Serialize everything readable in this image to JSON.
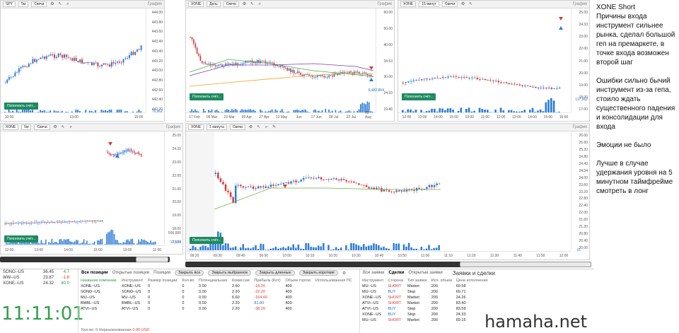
{
  "panels": {
    "p1": {
      "symbol": "SPY",
      "tf": "5м",
      "type": "Свечи",
      "graph": "График",
      "y": [
        "444.00",
        "443.80",
        "443.60",
        "443.49",
        "443.40",
        "443.20",
        "443.00",
        "442.80",
        "442.60",
        "442.40",
        "442.20"
      ],
      "x": [
        "10:00",
        "13:00",
        "15:00"
      ],
      "vol": "76,962",
      "btn": "Пополнить счёт..."
    },
    "p2": {
      "symbol": "XONE",
      "tf": "День",
      "type": "Свечи",
      "graph": "График",
      "y": [
        "60.00",
        "50.00",
        "40.00",
        "34.53",
        "30.00",
        "24.33",
        "19.46"
      ],
      "x": [
        "17 Feb",
        "05 Mar",
        "23 Mar",
        "09 Apr",
        "27 Apr",
        "13 May",
        "Jun",
        "17 Jun",
        "08 Jul",
        "22 Jul",
        "09 Aug"
      ],
      "vol": "6,482,854",
      "btn": "Пополнить счёт..."
    },
    "p3": {
      "symbol": "XONE",
      "tf": "15 минут",
      "type": "Свечи",
      "graph": "График",
      "y": [
        "25.00",
        "24.33",
        "23.00",
        "22.00",
        "21.00",
        "20.00",
        "19.00",
        "18.00",
        "17.00"
      ],
      "x": [
        "12:00",
        "13:00",
        "14:00",
        "15:00",
        "10:00",
        "11:00",
        "12:00",
        "13:00",
        "14:00",
        "15:00",
        "16:00"
      ],
      "vol": "117,962",
      "btn": "Пополнить счёт..."
    },
    "p4": {
      "symbol": "XONE",
      "tf": "5м",
      "type": "Свечи",
      "graph": "График",
      "y": [
        "25.00",
        "24.33",
        "23.00",
        "22.00",
        "21.00",
        "20.00",
        "19.00",
        "18.00",
        "17.00"
      ],
      "x": [
        "12:00",
        "13:00",
        "14:00",
        "15:00",
        "10:00",
        "11:00"
      ],
      "vol": "17,533",
      "vol2": "500,000",
      "btn": "Пополнить счёт..."
    },
    "p5": {
      "symbol": "XONE",
      "tf": "1 минута",
      "type": "Свечи",
      "graph": "График",
      "y": [
        "26.00",
        "25.60",
        "25.20",
        "24.80",
        "24.49",
        "24.34",
        "24.00",
        "23.60",
        "23.20",
        "22.80",
        "22.40",
        "22.00",
        "21.60",
        "21.20",
        "20.80",
        "20.40",
        "20.00"
      ],
      "x": [
        "09:20",
        "09:30",
        "09:40",
        "09:50",
        "10:00",
        "10:10",
        "10:20",
        "10:30",
        "10:40",
        "10:50",
        "11:00",
        "11:10",
        "11:20",
        "11:30",
        "11:40",
        "11:50",
        "12:00"
      ],
      "vol": "21",
      "btn": "Пополнить счёт..."
    }
  },
  "notes": {
    "title": "XONE Short",
    "reasons": "Причины входа инструмент сильнее рынка, сделал большой геп на премаркете, в точке входа возможен второй шаг",
    "errors": "Ошибки сильно бычий инструмент из-за гепа, стоило ждать существенного падения и консолидации для входа",
    "emotions": "Эмоции не было",
    "better": "Лучше в случае удержания уровня на 5 минутном таймфрейме смотреть в лонг"
  },
  "watchlist": [
    {
      "s": "SONO--US",
      "v": "36.45",
      "c": "4.7"
    },
    {
      "s": "WW--US",
      "v": "23.87",
      "c": "-1.8"
    },
    {
      "s": "XONE--US",
      "v": "24.32",
      "c": "40.0"
    }
  ],
  "clock": "11:11:01",
  "positions": {
    "tabs": [
      "Все позиции",
      "Открытые позиции",
      "Позиции"
    ],
    "buttons": [
      "Закрыть все",
      "Закрыть выбранное",
      "Закрыть длинные",
      "Закрыть короткие"
    ],
    "headers": [
      "Название компании",
      "Инструмент",
      "Размер позиции",
      "Кол-во",
      "Потенциальная",
      "Комиссии",
      "Прибыль (Кот)",
      "Объем торгов",
      "Использованная ПС"
    ],
    "rows": [
      [
        "XONE--US",
        "XONE--US",
        "0",
        "0",
        "0.00",
        "2.60",
        "-16.20",
        "400",
        ""
      ],
      [
        "SONO--US",
        "SONO--US",
        "0",
        "0",
        "0.00",
        "2.20",
        "-22.20",
        "400",
        ""
      ],
      [
        "MU--US",
        "MU--US",
        "0",
        "0",
        "0.00",
        "6.60",
        "-164.60",
        "400",
        ""
      ],
      [
        "BMBL--US",
        "BMBL--US",
        "0",
        "0",
        "0.00",
        "2.20",
        "81.80",
        "400",
        ""
      ],
      [
        "ATVI--US",
        "ATVI--US",
        "0",
        "0",
        "0.00",
        "2.20",
        "-38.20",
        "400",
        ""
      ]
    ],
    "footer_label": "Кол-во: 0    Нереализованная",
    "footer_value": "0.00 USD"
  },
  "deals": {
    "tabs": [
      "Все заявки",
      "Сделки",
      "Открытые заявки"
    ],
    "title": "Заявки и сделки",
    "headers": [
      "Инструмент",
      "Сторона",
      "Тип заявки",
      "Исп. объем",
      "Цена исполнения"
    ],
    "rows": [
      [
        "MU--US",
        "SHORT",
        "Market",
        "200",
        "69.58"
      ],
      [
        "MU--US",
        "BUY",
        "Stop",
        "200",
        "69.71"
      ],
      [
        "XONE--US",
        "SHORT",
        "Market",
        "200",
        "24.26"
      ],
      [
        "ATVI--US",
        "SHORT",
        "Market",
        "200",
        "83.40"
      ],
      [
        "ATVI--US",
        "BUY",
        "Stop",
        "200",
        "83.59"
      ],
      [
        "XONE--US",
        "BUY",
        "Stop",
        "200",
        "24.33"
      ],
      [
        "MU--US",
        "SHORT",
        "Market",
        "200",
        "69.15"
      ]
    ]
  },
  "brand": "hamaha.net"
}
